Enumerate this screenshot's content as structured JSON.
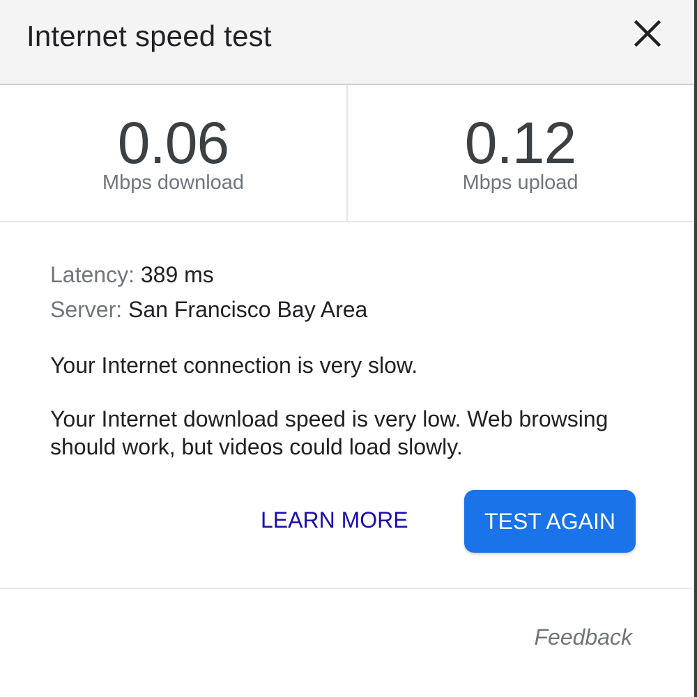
{
  "header": {
    "title": "Internet speed test",
    "close_icon": "close-icon"
  },
  "speeds": {
    "download": {
      "value": "0.06",
      "unit": "Mbps download"
    },
    "upload": {
      "value": "0.12",
      "unit": "Mbps upload"
    }
  },
  "details": {
    "latency_label": "Latency:",
    "latency_value": "389 ms",
    "server_label": "Server:",
    "server_value": "San Francisco Bay Area"
  },
  "messages": {
    "status": "Your Internet connection is very slow.",
    "explanation": "Your Internet download speed is very low. Web browsing should work, but videos could load slowly."
  },
  "actions": {
    "learn_more": "LEARN MORE",
    "test_again": "TEST AGAIN"
  },
  "footer": {
    "feedback": "Feedback"
  },
  "colors": {
    "primary_button": "#1a73e8",
    "link": "#1a0dab",
    "header_bg": "#f4f4f4"
  }
}
